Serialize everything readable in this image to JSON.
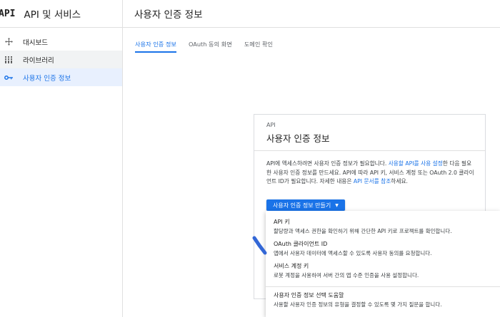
{
  "sidebar": {
    "logo": "API",
    "title": "API 및 서비스",
    "items": [
      {
        "label": "대시보드",
        "icon": "dashboard-icon"
      },
      {
        "label": "라이브러리",
        "icon": "library-icon"
      },
      {
        "label": "사용자 인증 정보",
        "icon": "key-icon"
      }
    ]
  },
  "header": {
    "title": "사용자 인증 정보"
  },
  "tabs": [
    {
      "label": "사용자 인증 정보"
    },
    {
      "label": "OAuth 동의 화면"
    },
    {
      "label": "도메인 확인"
    }
  ],
  "card": {
    "kicker": "API",
    "title": "사용자 인증 정보",
    "desc_1": "API에 액세스하려면 사용자 인증 정보가 필요합니다. ",
    "desc_link_1": "사용할 API를 사용 설정",
    "desc_2": "한 다음 필요한 사용자 인증 정보를 만드세요. API에 따라 API 키, 서비스 계정 또는 OAuth 2.0 클라이언트 ID가 필요합니다. 자세한 내용은 ",
    "desc_link_2": "API 문서를 참조",
    "desc_3": "하세요."
  },
  "create_button": {
    "label": "사용자 인증 정보 만들기"
  },
  "menu": {
    "items": [
      {
        "title": "API 키",
        "desc": "할당량과 액세스 권한을 확인하기 위해 간단한 API 키로 프로젝트를 확인합니다."
      },
      {
        "title": "OAuth 클라이언트 ID",
        "desc": "앱에서 사용자 데이터에 액세스할 수 있도록 사용자 동의를 요청합니다."
      },
      {
        "title": "서비스 계정 키",
        "desc": "로봇 계정을 사용하여 서버 간의 앱 수준 인증을 사용 설정합니다."
      },
      {
        "title": "사용자 인증 정보 선택 도움말",
        "desc": "사용할 사용자 인증 정보의 유형을 결정할 수 있도록 몇 가지 질문을 합니다."
      }
    ]
  },
  "colors": {
    "accent": "#1a73e8",
    "selected_bg": "#e8f0fe"
  }
}
